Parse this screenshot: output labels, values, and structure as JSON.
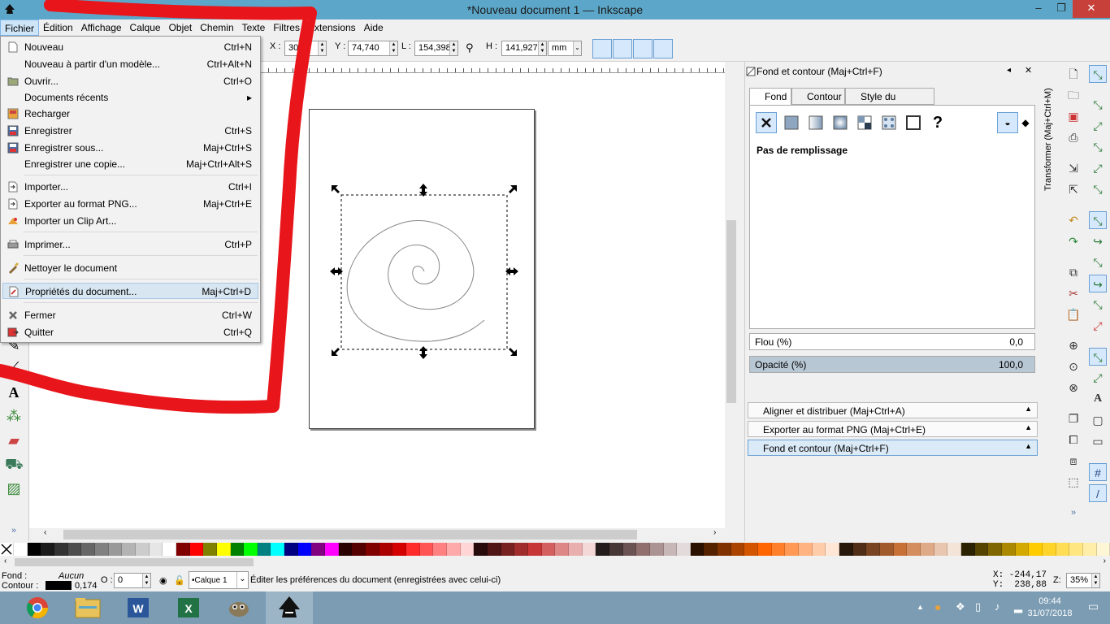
{
  "window": {
    "title": "*Nouveau document 1 — Inkscape",
    "controls": {
      "minimize": "–",
      "restore": "❐",
      "close": "✕"
    }
  },
  "menubar": [
    {
      "label": "Fichier",
      "active": true
    },
    {
      "label": "Édition"
    },
    {
      "label": "Affichage"
    },
    {
      "label": "Calque"
    },
    {
      "label": "Objet"
    },
    {
      "label": "Chemin"
    },
    {
      "label": "Texte"
    },
    {
      "label": "Filtres"
    },
    {
      "label": "Extensions"
    },
    {
      "label": "Aide"
    }
  ],
  "file_menu": {
    "items": [
      {
        "label": "Nouveau",
        "shortcut": "Ctrl+N",
        "icon": "new-document-icon"
      },
      {
        "label": "Nouveau à partir d'un modèle...",
        "shortcut": "Ctrl+Alt+N",
        "icon": ""
      },
      {
        "label": "Ouvrir...",
        "shortcut": "Ctrl+O",
        "icon": "open-folder-icon"
      },
      {
        "label": "Documents récents",
        "shortcut": "",
        "icon": "",
        "submenu": true
      },
      {
        "label": "Recharger",
        "shortcut": "",
        "icon": "reload-icon"
      },
      {
        "label": "Enregistrer",
        "shortcut": "Ctrl+S",
        "icon": "save-icon"
      },
      {
        "label": "Enregistrer sous...",
        "shortcut": "Maj+Ctrl+S",
        "icon": "save-as-icon"
      },
      {
        "label": "Enregistrer une copie...",
        "shortcut": "Maj+Ctrl+Alt+S",
        "icon": ""
      },
      {
        "label": "Importer...",
        "shortcut": "Ctrl+I",
        "icon": "import-icon"
      },
      {
        "label": "Exporter au format PNG...",
        "shortcut": "Maj+Ctrl+E",
        "icon": "export-png-icon"
      },
      {
        "label": "Importer un Clip Art...",
        "shortcut": "",
        "icon": "clip-art-icon"
      },
      {
        "label": "Imprimer...",
        "shortcut": "Ctrl+P",
        "icon": "print-icon"
      },
      {
        "label": "Nettoyer le document",
        "shortcut": "",
        "icon": "clean-icon"
      },
      {
        "label": "Propriétés du document...",
        "shortcut": "Maj+Ctrl+D",
        "icon": "document-properties-icon",
        "highlighted": true
      },
      {
        "label": "Fermer",
        "shortcut": "Ctrl+W",
        "icon": "close-document-icon"
      },
      {
        "label": "Quitter",
        "shortcut": "Ctrl+Q",
        "icon": "quit-icon"
      }
    ]
  },
  "toolbar": {
    "x_label": "X :",
    "x_value": "30",
    "y_label": "Y :",
    "y_value": "74,740",
    "w_label": "L :",
    "w_value": "154,398",
    "h_label": "H :",
    "h_value": "141,927",
    "unit": "mm"
  },
  "dock": {
    "title": "Fond et contour (Maj+Ctrl+F)",
    "tabs": [
      "Fond",
      "Contour",
      "Style du contour"
    ],
    "fill_state_label": "Pas de remplissage",
    "blur_label": "Flou (%)",
    "blur_value": "0,0",
    "opacity_label": "Opacité (%)",
    "opacity_value": "100,0",
    "collapsed_panels": [
      "Aligner et distribuer (Maj+Ctrl+A)",
      "Exporter au format PNG (Maj+Ctrl+E)",
      "Fond et contour (Maj+Ctrl+F)"
    ],
    "vertical_tab": "Transformer (Maj+Ctrl+M)"
  },
  "statusbar": {
    "fill_label": "Fond :",
    "fill_value": "Aucun",
    "stroke_label": "Contour :",
    "stroke_width": "0,174",
    "opacity_label": "O :",
    "opacity_value": "0",
    "layer": "•Calque 1",
    "message": "Éditer les préférences du document (enregistrées avec celui-ci)",
    "x_coord": "X: -244,17",
    "y_coord": "Y:  238,88",
    "zoom_label": "Z:",
    "zoom_value": "35%"
  },
  "taskbar": {
    "time": "09:44",
    "date": "31/07/2018"
  },
  "colors": {
    "accent": "#5ca7c9",
    "annotation_red": "#e8151b",
    "highlight": "#d8e6f2"
  }
}
